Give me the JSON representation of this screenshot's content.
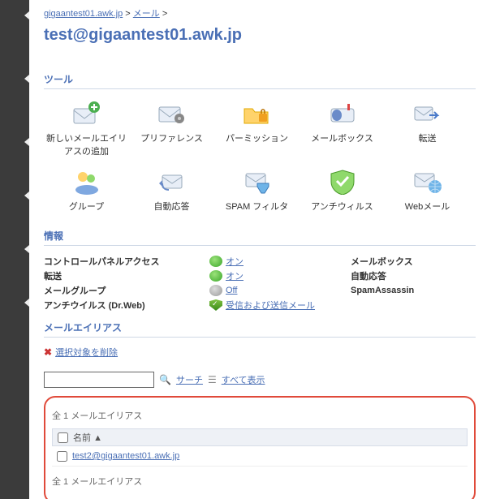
{
  "breadcrumb": {
    "a": "gigaantest01.awk.jp",
    "b": "メール",
    "sep": ">"
  },
  "title": "test@gigaantest01.awk.jp",
  "sections": {
    "tools": "ツール",
    "info": "情報",
    "aliases": "メールエイリアス"
  },
  "tools": [
    {
      "label": "新しいメールエイリアスの追加"
    },
    {
      "label": "プリファレンス"
    },
    {
      "label": "パーミッション"
    },
    {
      "label": "メールボックス"
    },
    {
      "label": "転送"
    },
    {
      "label": "グループ"
    },
    {
      "label": "自動応答"
    },
    {
      "label": "SPAM フィルタ"
    },
    {
      "label": "アンチウィルス"
    },
    {
      "label": "Webメール"
    }
  ],
  "info": {
    "left": [
      {
        "label": "コントロールパネルアクセス"
      },
      {
        "label": "転送"
      },
      {
        "label": "メールグループ"
      },
      {
        "label": "アンチウイルス (Dr.Web)"
      }
    ],
    "mid": [
      {
        "value": "オン",
        "type": "on"
      },
      {
        "value": "オン",
        "type": "on"
      },
      {
        "value": "Off",
        "type": "off"
      },
      {
        "value": "受信および送信メール",
        "type": "shield"
      }
    ],
    "right": [
      {
        "label": "メールボックス"
      },
      {
        "label": "自動応答"
      },
      {
        "label": "SpamAssassin"
      }
    ]
  },
  "actions": {
    "delete": "選択対象を削除"
  },
  "search": {
    "placeholder": "",
    "btn_search": "サーチ",
    "btn_all": "すべて表示"
  },
  "list": {
    "count": "全 1 メールエイリアス",
    "col_name": "名前",
    "sort": "▲",
    "items": [
      {
        "name": "test2@gigaantest01.awk.jp"
      }
    ]
  }
}
